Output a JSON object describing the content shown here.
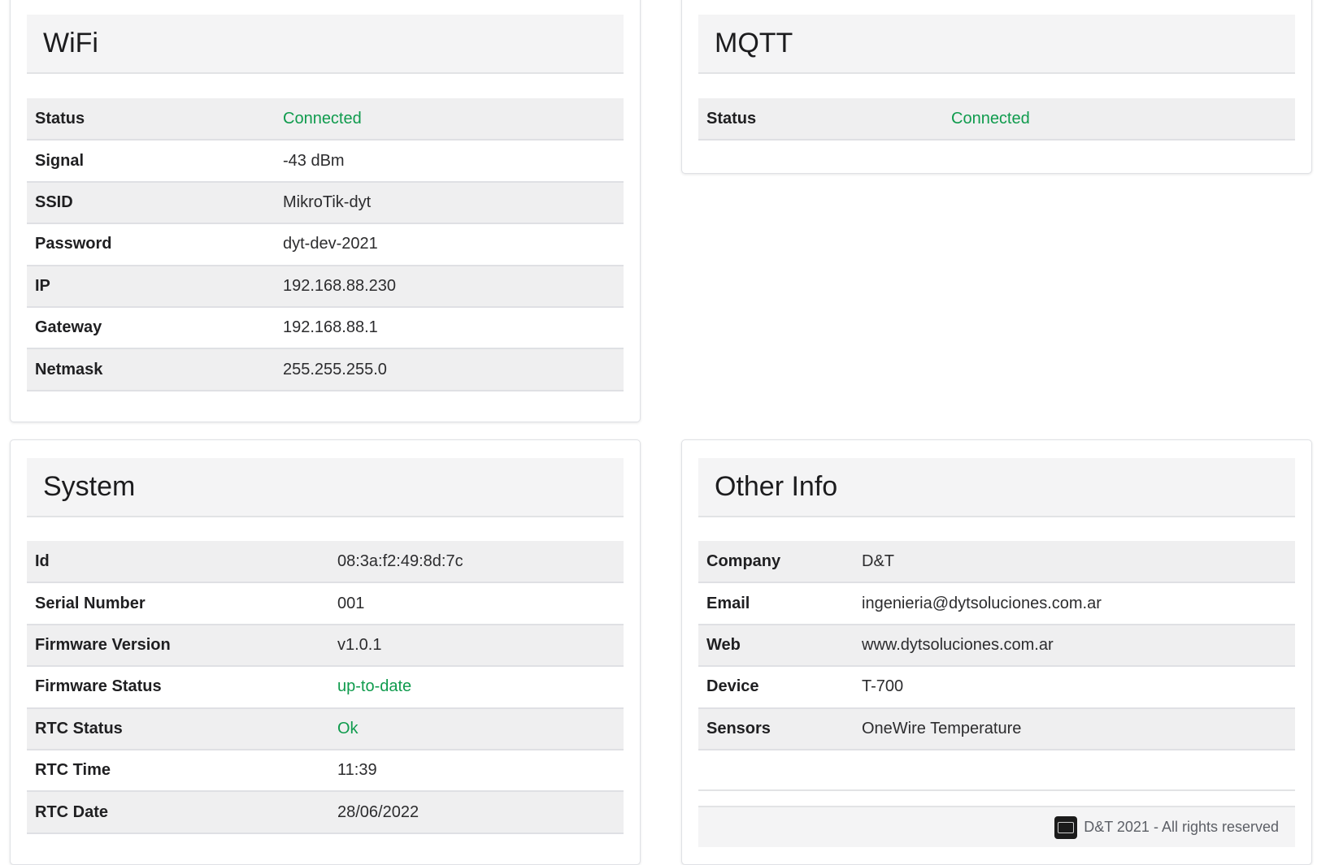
{
  "wifi": {
    "title": "WiFi",
    "rows": [
      {
        "key": "Status",
        "value": "Connected"
      },
      {
        "key": "Signal",
        "value": "-43 dBm"
      },
      {
        "key": "SSID",
        "value": "MikroTik-dyt"
      },
      {
        "key": "Password",
        "value": "dyt-dev-2021"
      },
      {
        "key": "IP",
        "value": "192.168.88.230"
      },
      {
        "key": "Gateway",
        "value": "192.168.88.1"
      },
      {
        "key": "Netmask",
        "value": "255.255.255.0"
      }
    ]
  },
  "mqtt": {
    "title": "MQTT",
    "rows": [
      {
        "key": "Status",
        "value": "Connected"
      }
    ]
  },
  "system": {
    "title": "System",
    "rows": [
      {
        "key": "Id",
        "value": "08:3a:f2:49:8d:7c"
      },
      {
        "key": "Serial Number",
        "value": "001"
      },
      {
        "key": "Firmware Version",
        "value": "v1.0.1"
      },
      {
        "key": "Firmware Status",
        "value": "up-to-date"
      },
      {
        "key": "RTC Status",
        "value": "Ok"
      },
      {
        "key": "RTC Time",
        "value": "11:39"
      },
      {
        "key": "RTC Date",
        "value": "28/06/2022"
      }
    ]
  },
  "other": {
    "title": "Other Info",
    "rows": [
      {
        "key": "Company",
        "value": "D&T"
      },
      {
        "key": "Email",
        "value": "ingenieria@dytsoluciones.com.ar"
      },
      {
        "key": "Web",
        "value": "www.dytsoluciones.com.ar"
      },
      {
        "key": "Device",
        "value": "T-700"
      },
      {
        "key": "Sensors",
        "value": "OneWire Temperature"
      }
    ],
    "footer_text": "D&T 2021 - All rights reserved",
    "footer_logo_icon": "dt-logo-icon"
  },
  "colors": {
    "ok_green": "#0f9b4d",
    "header_bg": "#f4f4f5",
    "stripe_bg": "#efeff0"
  }
}
